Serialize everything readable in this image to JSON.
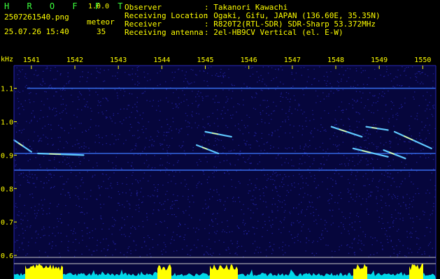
{
  "header": {
    "app_title": "H R O F F T",
    "app_version": "1.0.0",
    "filename": "2507261540.png",
    "datetime": "25.07.26 15:40",
    "mode": "meteor",
    "count": "35"
  },
  "info": [
    {
      "key": "Observer",
      "value": ": Takanori Kawachi"
    },
    {
      "key": "Receiving Location",
      "value": ": Ogaki, Gifu, JAPAN (136.60E, 35.35N)"
    },
    {
      "key": "Receiver",
      "value": ": R820T2(RTL-SDR) SDR-Sharp 53.372MHz"
    },
    {
      "key": "Receiving antenna",
      "value": ": 2el-HB9CV Vertical (el. E-W)"
    }
  ],
  "spectrogram": {
    "y_unit": "kHz",
    "x_ticks": [
      "1541",
      "1542",
      "1543",
      "1544",
      "1545",
      "1546",
      "1547",
      "1548",
      "1549",
      "1550"
    ],
    "y_ticks": [
      "1.1",
      "1.0",
      "0.9",
      "0.8",
      "0.7",
      "0.6"
    ],
    "x_range": [
      1540.6,
      1550.3
    ],
    "y_range": [
      0.594,
      1.168
    ],
    "colors": {
      "background": "#06063c",
      "noise": "#2828b4",
      "echo": "#5fc8ff",
      "echo_core": "#ffff80",
      "axis": "#ffff00",
      "level_fill": "#00d8e8",
      "level_peak": "#ffff00"
    },
    "carriers": [
      {
        "y": 1.1,
        "x0": 1540.9,
        "x1": 1550.3
      },
      {
        "y": 0.905,
        "x0": 1540.6,
        "x1": 1550.3
      },
      {
        "y": 0.855,
        "x0": 1540.6,
        "x1": 1550.3
      }
    ],
    "echoes": [
      {
        "x0": 1540.6,
        "y0": 0.945,
        "x1": 1541.0,
        "y1": 0.91
      },
      {
        "x0": 1541.15,
        "y0": 0.905,
        "x1": 1542.2,
        "y1": 0.9
      },
      {
        "x0": 1544.8,
        "y0": 0.93,
        "x1": 1545.3,
        "y1": 0.905
      },
      {
        "x0": 1545.0,
        "y0": 0.97,
        "x1": 1545.6,
        "y1": 0.955
      },
      {
        "x0": 1547.9,
        "y0": 0.985,
        "x1": 1548.6,
        "y1": 0.955
      },
      {
        "x0": 1548.7,
        "y0": 0.985,
        "x1": 1549.2,
        "y1": 0.975
      },
      {
        "x0": 1549.35,
        "y0": 0.97,
        "x1": 1550.2,
        "y1": 0.92
      },
      {
        "x0": 1548.4,
        "y0": 0.92,
        "x1": 1549.2,
        "y1": 0.895
      },
      {
        "x0": 1549.1,
        "y0": 0.915,
        "x1": 1549.6,
        "y1": 0.89
      }
    ]
  }
}
